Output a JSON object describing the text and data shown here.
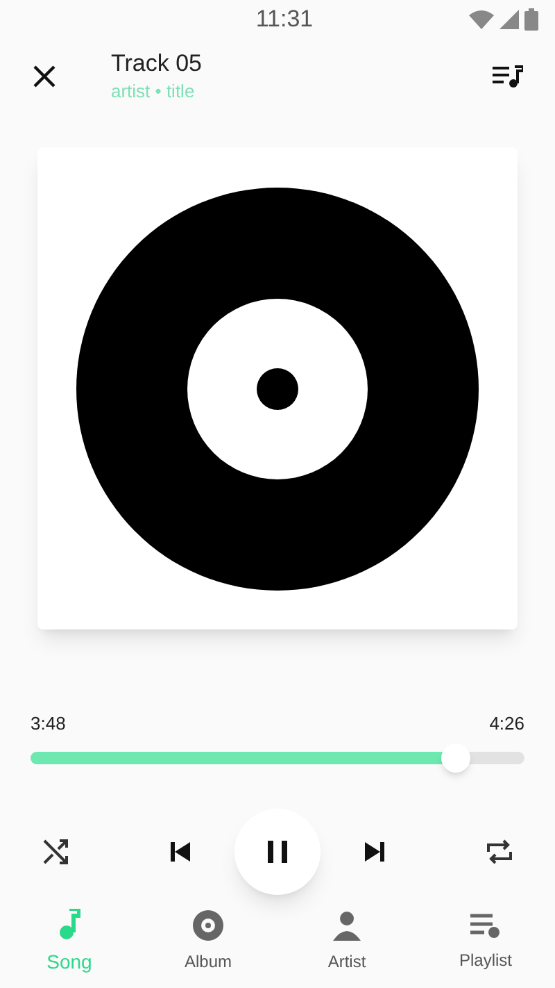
{
  "status_bar": {
    "time": "11:31"
  },
  "header": {
    "title": "Track 05",
    "subtitle": "artist • title"
  },
  "player": {
    "elapsed": "3:48",
    "duration": "4:26",
    "level": 0.86,
    "playing": true
  },
  "tabs": [
    {
      "label": "Song",
      "kind": "song",
      "selected": true
    },
    {
      "label": "Album",
      "kind": "album",
      "selected": false
    },
    {
      "label": "Artist",
      "kind": "artist",
      "selected": false
    },
    {
      "label": "Playlist",
      "kind": "playlist",
      "selected": false
    }
  ]
}
